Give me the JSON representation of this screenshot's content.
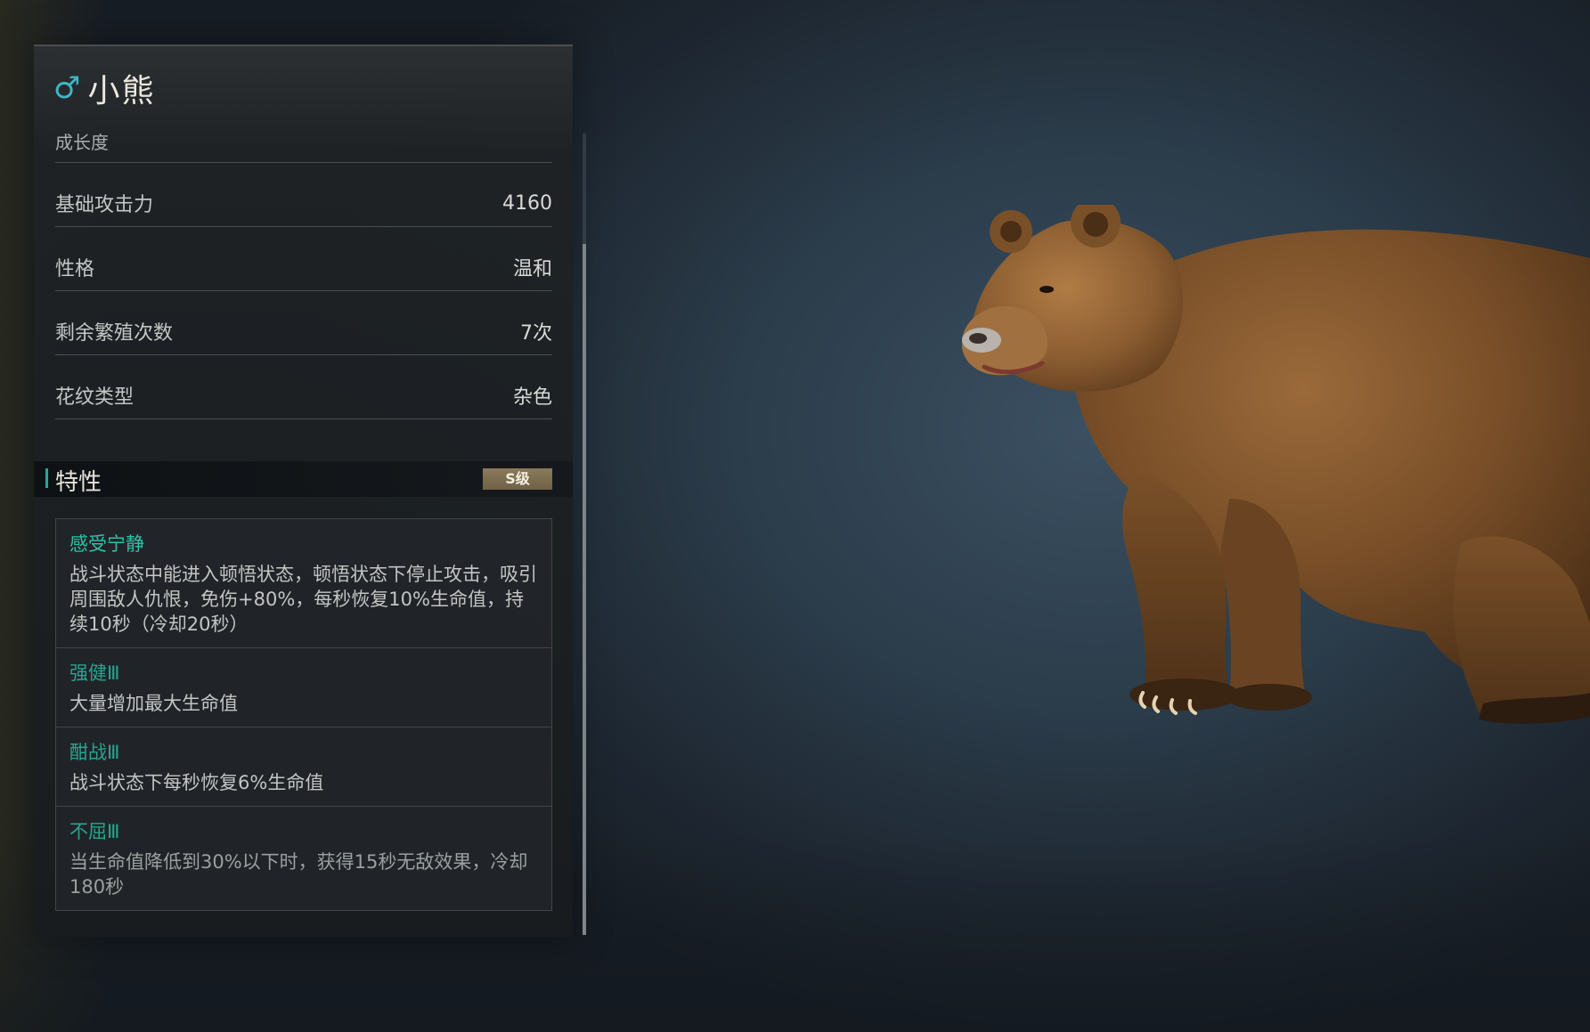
{
  "pet": {
    "gender_icon": "♂",
    "name": "小熊",
    "growth_label": "成长度"
  },
  "stats": [
    {
      "label": "基础攻击力",
      "value": "4160"
    },
    {
      "label": "性格",
      "value": "温和"
    },
    {
      "label": "剩余繁殖次数",
      "value": "7次"
    },
    {
      "label": "花纹类型",
      "value": "杂色"
    }
  ],
  "traits": {
    "title": "特性",
    "grade": "S级",
    "items": [
      {
        "name": "感受宁静",
        "desc": "战斗状态中能进入顿悟状态，顿悟状态下停止攻击，吸引周围敌人仇恨，免伤+80%，每秒恢复10%生命值，持续10秒（冷却20秒）"
      },
      {
        "name": "强健Ⅲ",
        "desc": "大量增加最大生命值"
      },
      {
        "name": "酣战Ⅲ",
        "desc": "战斗状态下每秒恢复6%生命值"
      },
      {
        "name": "不屈Ⅲ",
        "desc": "当生命值降低到30%以下时，获得15秒无敌效果，冷却180秒"
      }
    ]
  },
  "colors": {
    "accent_teal": "#2fc2a6",
    "gender_blue": "#3fb5c6",
    "grade_badge": "#8b7a5a"
  },
  "icons": {
    "gender": "male-icon",
    "model": "brown-bear-model"
  }
}
